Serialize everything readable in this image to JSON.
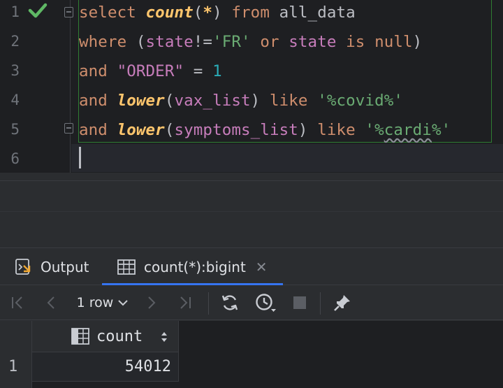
{
  "editor": {
    "line_numbers": [
      "1",
      "2",
      "3",
      "4",
      "5",
      "6"
    ],
    "lines": [
      [
        {
          "t": "select ",
          "c": "kw"
        },
        {
          "t": "count",
          "c": "fn"
        },
        {
          "t": "(",
          "c": "plain"
        },
        {
          "t": "*",
          "c": "fn"
        },
        {
          "t": ") ",
          "c": "plain"
        },
        {
          "t": "from ",
          "c": "kw"
        },
        {
          "t": "all_data",
          "c": "id"
        }
      ],
      [
        {
          "t": "where ",
          "c": "kw"
        },
        {
          "t": "(",
          "c": "plain"
        },
        {
          "t": "state",
          "c": "col"
        },
        {
          "t": "!=",
          "c": "plain"
        },
        {
          "t": "'FR'",
          "c": "str"
        },
        {
          "t": " or ",
          "c": "kw"
        },
        {
          "t": "state",
          "c": "col"
        },
        {
          "t": " is null",
          "c": "kw"
        },
        {
          "t": ")",
          "c": "plain"
        }
      ],
      [
        {
          "t": "and ",
          "c": "kw"
        },
        {
          "t": "\"ORDER\"",
          "c": "quoted"
        },
        {
          "t": " = ",
          "c": "plain"
        },
        {
          "t": "1",
          "c": "num"
        }
      ],
      [
        {
          "t": "and ",
          "c": "kw"
        },
        {
          "t": "lower",
          "c": "fn"
        },
        {
          "t": "(",
          "c": "plain"
        },
        {
          "t": "vax_list",
          "c": "col"
        },
        {
          "t": ") ",
          "c": "plain"
        },
        {
          "t": "like ",
          "c": "kw"
        },
        {
          "t": "'%covid%'",
          "c": "str"
        }
      ],
      [
        {
          "t": "and ",
          "c": "kw"
        },
        {
          "t": "lower",
          "c": "fn"
        },
        {
          "t": "(",
          "c": "plain"
        },
        {
          "t": "symptoms_list",
          "c": "col"
        },
        {
          "t": ") ",
          "c": "plain"
        },
        {
          "t": "like ",
          "c": "kw"
        },
        {
          "t": "'%",
          "c": "str"
        },
        {
          "t": "cardi",
          "c": "str squiggle"
        },
        {
          "t": "%'",
          "c": "str"
        }
      ]
    ]
  },
  "tabs": {
    "output_label": "Output",
    "result_label": "count(*):bigint"
  },
  "toolbar": {
    "rows_label": "1 row"
  },
  "grid": {
    "column_header": "count",
    "rows": [
      {
        "num": "1",
        "value": "54012"
      }
    ]
  },
  "colors": {
    "accent": "#3574f0",
    "run_ok": "#5fb865",
    "keyword": "#cf8e6d",
    "function": "#ffc66d",
    "string": "#6aab73"
  }
}
